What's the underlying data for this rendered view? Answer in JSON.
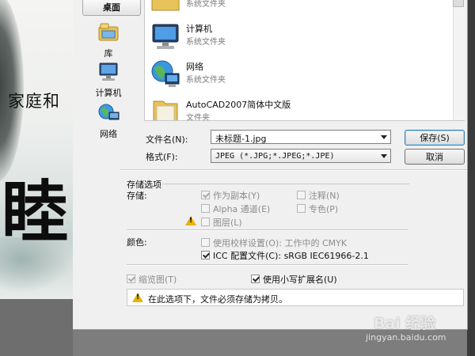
{
  "background": {
    "calligraphy_line": "家庭和",
    "calligraphy_big": "睦"
  },
  "places": [
    {
      "label": "桌面",
      "icon": "desktop-icon",
      "selected": true
    },
    {
      "label": "库",
      "icon": "library-icon"
    },
    {
      "label": "计算机",
      "icon": "computer-icon"
    },
    {
      "label": "网络",
      "icon": "network-icon"
    }
  ],
  "file_list": [
    {
      "name": "",
      "type": "系统文件夹",
      "icon": "folder-icon"
    },
    {
      "name": "计算机",
      "type": "系统文件夹",
      "icon": "computer-icon"
    },
    {
      "name": "网络",
      "type": "系统文件夹",
      "icon": "network-globe-icon"
    },
    {
      "name": "AutoCAD2007简体中文版",
      "type": "文件夹",
      "icon": "folder-icon"
    }
  ],
  "filename": {
    "label": "文件名(N):",
    "value": "未标题-1.jpg"
  },
  "format": {
    "label": "格式(F):",
    "value": "JPEG (*.JPG;*.JPEG;*.JPE)"
  },
  "buttons": {
    "save": "保存(S)",
    "cancel": "取消"
  },
  "options": {
    "section_title": "存储选项",
    "storage_label": "存储:",
    "as_copy": "作为副本(Y)",
    "notes": "注释(N)",
    "alpha": "Alpha 通道(E)",
    "spot": "专色(P)",
    "layers": "图层(L)",
    "color_label": "颜色:",
    "proof": "使用校样设置(O):  工作中的 CMYK",
    "icc": "ICC 配置文件(C):  sRGB IEC61966-2.1",
    "thumbnail": "缩览图(T)",
    "lowercase": "使用小写扩展名(U)",
    "warning": "在此选项下，文件必须存储为拷贝。"
  },
  "watermark": {
    "brand": "Bai  经验",
    "url": "jingyan.baidu.com"
  },
  "colors": {
    "warning": "#e9b300",
    "default_button_border": "#3c7fb1"
  }
}
